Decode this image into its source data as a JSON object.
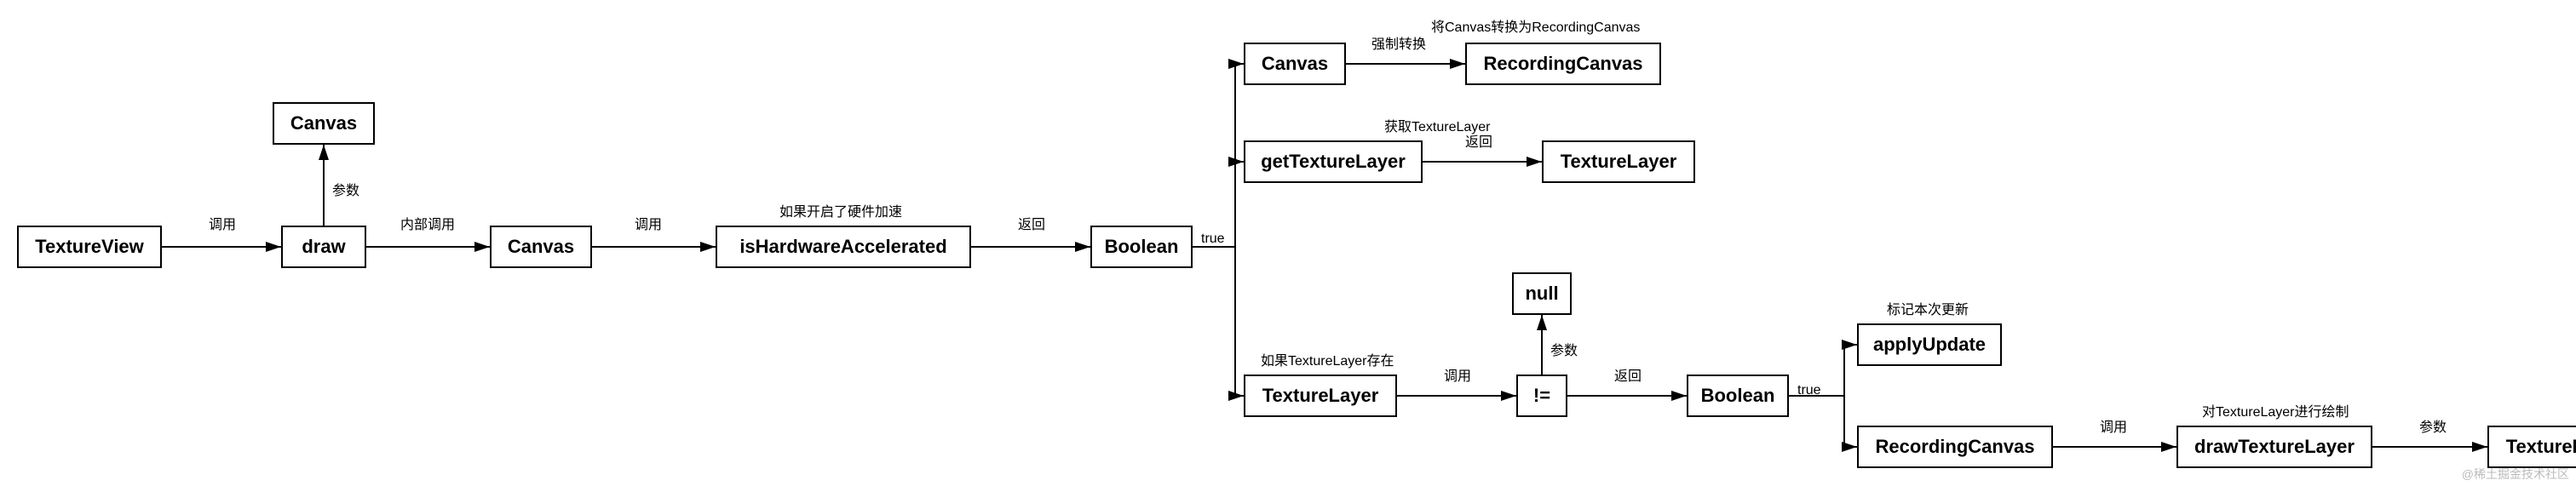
{
  "nodes": {
    "textureView": "TextureView",
    "draw": "draw",
    "canvasParam": "Canvas",
    "canvasInner": "Canvas",
    "isHwAccel": "isHardwareAccelerated",
    "boolean1": "Boolean",
    "canvasTop": "Canvas",
    "recordingCanvasTop": "RecordingCanvas",
    "getTextureLayer": "getTextureLayer",
    "textureLayerTop": "TextureLayer",
    "textureLayerBottom": "TextureLayer",
    "notEqual": "!=",
    "nullNode": "null",
    "boolean2": "Boolean",
    "applyUpdate": "applyUpdate",
    "recordingCanvasBottom": "RecordingCanvas",
    "drawTextureLayer": "drawTextureLayer",
    "textureLayerEnd": "TextureLayer"
  },
  "edges": {
    "e1": "调用",
    "e2": "参数",
    "e3": "内部调用",
    "e4": "调用",
    "e5": "如果开启了硬件加速",
    "e6": "返回",
    "e7": "true",
    "e8": "强制转换",
    "e9": "将Canvas转换为RecordingCanvas",
    "e10": "获取TextureLayer",
    "e11": "返回",
    "e12": "如果TextureLayer存在",
    "e13": "调用",
    "e14": "参数",
    "e15": "返回",
    "e16": "true",
    "e17": "标记本次更新",
    "e18": "调用",
    "e19": "对TextureLayer进行绘制",
    "e20": "参数"
  },
  "watermark": "@稀土掘金技术社区"
}
